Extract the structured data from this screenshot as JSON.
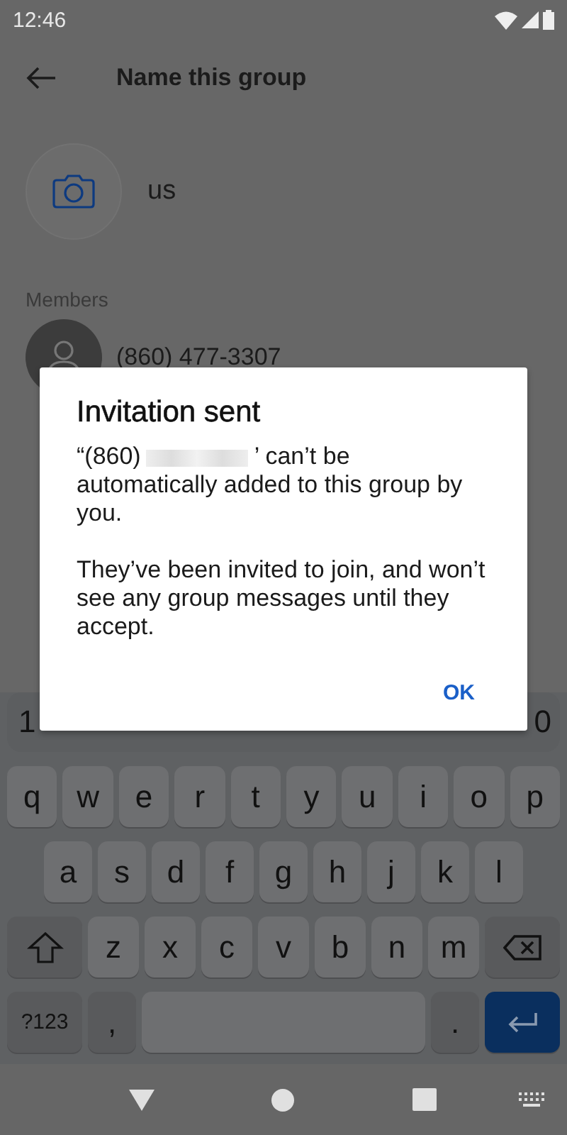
{
  "status_bar": {
    "time": "12:46"
  },
  "header": {
    "title": "Name this group"
  },
  "group": {
    "name": "us"
  },
  "members": {
    "label": "Members",
    "items": [
      {
        "name": "(860) 477-3307"
      }
    ]
  },
  "dialog": {
    "title": "Invitation sent",
    "message_start": "“(860)",
    "redacted": true,
    "message_end": "’ can’t be automatically added to this group by you.",
    "detail": "They’ve been invited to join, and won’t see any group messages until they accept.",
    "button": "OK"
  },
  "keyboard": {
    "number_row": [
      "1",
      "0"
    ],
    "rows": [
      [
        {
          "kind": "letter",
          "label": "q"
        },
        {
          "kind": "letter",
          "label": "w"
        },
        {
          "kind": "letter",
          "label": "e"
        },
        {
          "kind": "letter",
          "label": "r"
        },
        {
          "kind": "letter",
          "label": "t"
        },
        {
          "kind": "letter",
          "label": "y"
        },
        {
          "kind": "letter",
          "label": "u"
        },
        {
          "kind": "letter",
          "label": "i"
        },
        {
          "kind": "letter",
          "label": "o"
        },
        {
          "kind": "letter",
          "label": "p"
        }
      ],
      [
        {
          "kind": "letter",
          "label": "a"
        },
        {
          "kind": "letter",
          "label": "s"
        },
        {
          "kind": "letter",
          "label": "d"
        },
        {
          "kind": "letter",
          "label": "f"
        },
        {
          "kind": "letter",
          "label": "g"
        },
        {
          "kind": "letter",
          "label": "h"
        },
        {
          "kind": "letter",
          "label": "j"
        },
        {
          "kind": "letter",
          "label": "k"
        },
        {
          "kind": "letter",
          "label": "l"
        }
      ],
      [
        {
          "kind": "shift"
        },
        {
          "kind": "letter",
          "label": "z"
        },
        {
          "kind": "letter",
          "label": "x"
        },
        {
          "kind": "letter",
          "label": "c"
        },
        {
          "kind": "letter",
          "label": "v"
        },
        {
          "kind": "letter",
          "label": "b"
        },
        {
          "kind": "letter",
          "label": "n"
        },
        {
          "kind": "letter",
          "label": "m"
        },
        {
          "kind": "backspace"
        }
      ],
      [
        {
          "kind": "symbols",
          "label": "?123"
        },
        {
          "kind": "punct",
          "label": ","
        },
        {
          "kind": "space"
        },
        {
          "kind": "punct",
          "label": "."
        },
        {
          "kind": "enter"
        }
      ]
    ]
  }
}
